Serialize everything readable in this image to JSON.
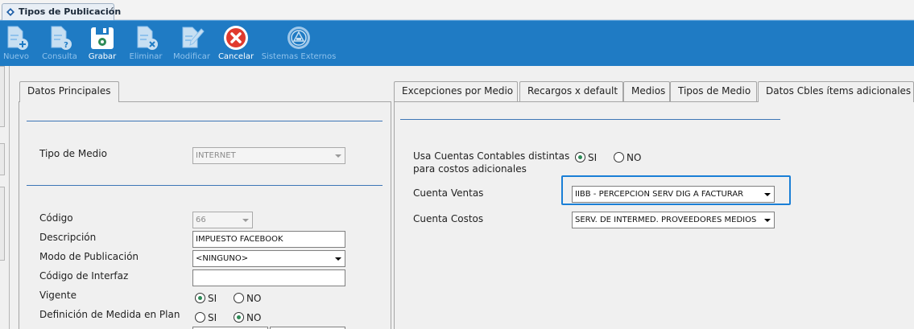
{
  "window_tab": {
    "title": "Tipos de Publicación"
  },
  "toolbar": {
    "nuevo": "Nuevo",
    "consulta": "Consulta",
    "grabar": "Grabar",
    "eliminar": "Eliminar",
    "modificar": "Modificar",
    "cancelar": "Cancelar",
    "sistemas_externos": "Sistemas Externos"
  },
  "left_panel": {
    "tab": "Datos Principales",
    "tipo_medio_label": "Tipo de Medio",
    "tipo_medio_value": "INTERNET",
    "codigo_label": "Código",
    "codigo_value": "66",
    "descripcion_label": "Descripción",
    "descripcion_value": "IMPUESTO FACEBOOK",
    "modo_label": "Modo de Publicación",
    "modo_value": "<NINGUNO>",
    "interfaz_label": "Código de Interfaz",
    "interfaz_value": "",
    "vigente_label": "Vigente",
    "vigente_si": "SI",
    "vigente_no": "NO",
    "vigente_selected": "SI",
    "medida_label": "Definición de Medida en Plan",
    "medida_si": "SI",
    "medida_no": "NO",
    "medida_selected": "NO"
  },
  "right_panel": {
    "tabs": [
      "Excepciones por Medio",
      "Recargos x default",
      "Medios",
      "Tipos de Medio",
      "Datos Cbles ítems adicionales"
    ],
    "usa_cuentas_label_1": "Usa Cuentas Contables distintas",
    "usa_cuentas_label_2": "para costos adicionales",
    "usa_si": "SI",
    "usa_no": "NO",
    "usa_selected": "SI",
    "cuenta_ventas_label": "Cuenta Ventas",
    "cuenta_ventas_value": "IIBB - PERCEPCION SERV DIG A FACTURAR",
    "cuenta_costos_label": "Cuenta Costos",
    "cuenta_costos_value": "SERV. DE INTERMED. PROVEEDORES MEDIOS"
  },
  "colors": {
    "toolbar_bg": "#1f7bc4",
    "separator": "#3d76b6",
    "focus": "#1a7fd6",
    "radio_dot": "#2e8b57",
    "cancel_red": "#e03a2e"
  }
}
